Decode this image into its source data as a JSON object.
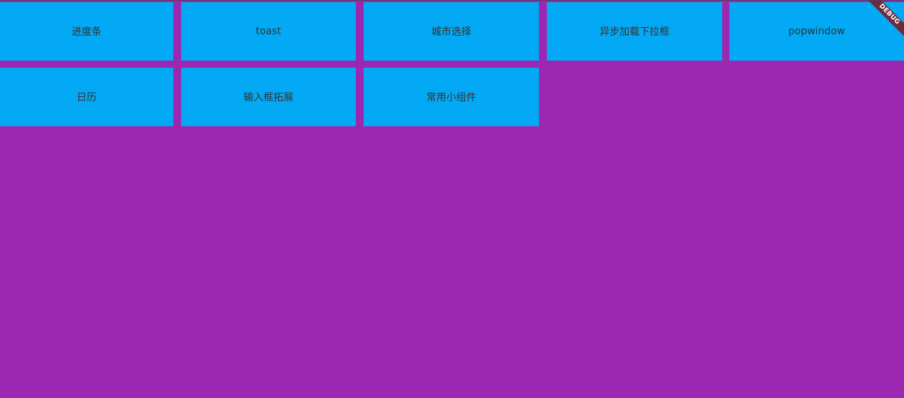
{
  "menu": {
    "items": [
      {
        "label": "进度条"
      },
      {
        "label": "toast"
      },
      {
        "label": "城市选择"
      },
      {
        "label": "异步加载下拉框"
      },
      {
        "label": "popwindow"
      },
      {
        "label": "日历"
      },
      {
        "label": "输入框拓展"
      },
      {
        "label": "常用小组件"
      }
    ]
  },
  "debug_banner": {
    "label": "DEBUG"
  },
  "colors": {
    "background": "#9c27b0",
    "tile": "#03a9f4",
    "banner": "#6b2c3c"
  }
}
